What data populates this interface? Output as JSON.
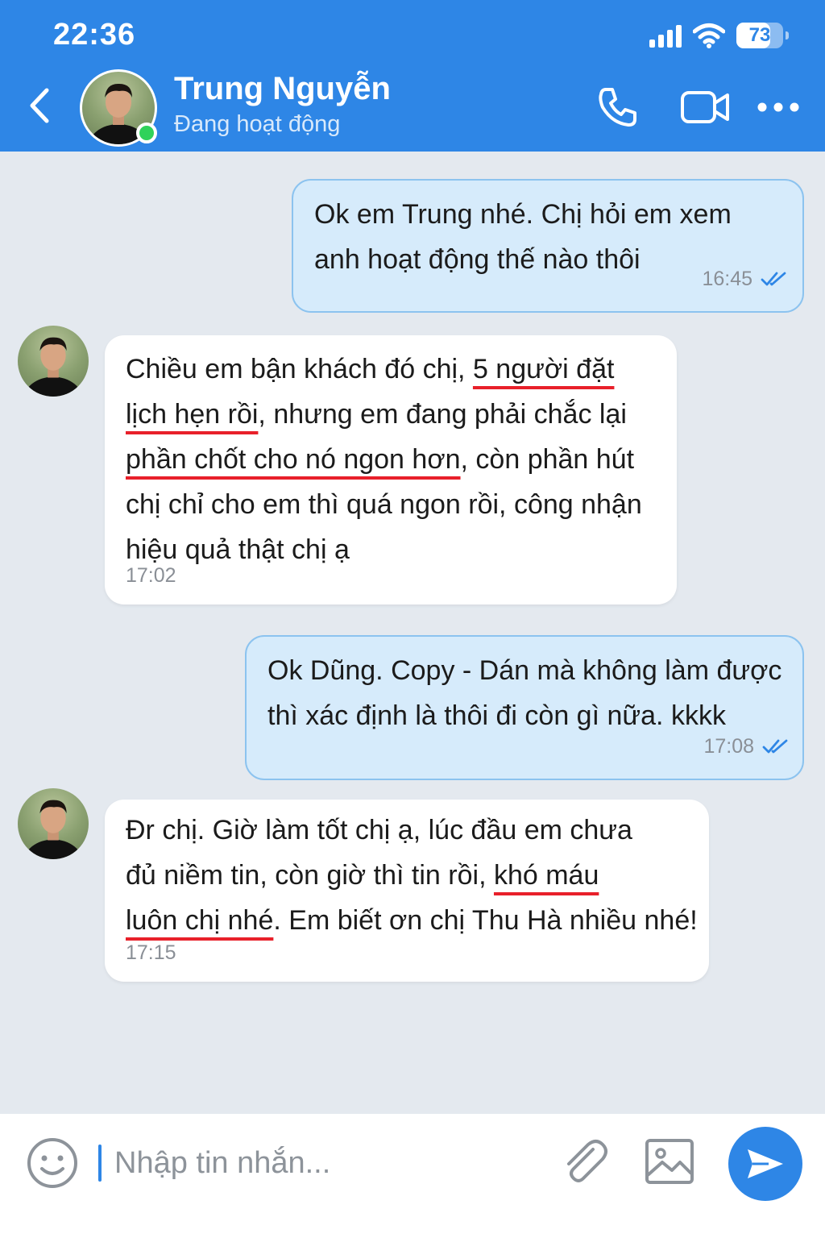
{
  "status_bar": {
    "time": "22:36",
    "battery": "73"
  },
  "header": {
    "contact_name": "Trung Nguyễn",
    "contact_status": "Đang hoạt động",
    "icons": [
      "back-icon",
      "phone-icon",
      "video-icon",
      "more-icon"
    ]
  },
  "messages": [
    {
      "direction": "outgoing",
      "lines": [
        "Ok em Trung nhé. Chị hỏi em xem",
        "anh hoạt động thế nào thôi"
      ],
      "time": "16:45",
      "status": "read"
    },
    {
      "direction": "incoming",
      "line1_pre": "Chiều em bận khách đó chị, ",
      "line1_u": "5 người đặt",
      "line2_u": "lịch hẹn rồi",
      "line2_post": ", nhưng em đang phải chắc lại",
      "line3_u": "phần chốt cho nó ngon hơn",
      "line3_post": ", còn phần hút",
      "line4": "chị chỉ cho em thì quá ngon rồi, công nhận",
      "line5": "hiệu quả thật chị ạ",
      "time": "17:02"
    },
    {
      "direction": "outgoing",
      "lines": [
        "Ok Dũng. Copy - Dán mà không làm được",
        "thì xác định là thôi đi còn gì nữa. kkkk"
      ],
      "time": "17:08",
      "status": "read"
    },
    {
      "direction": "incoming",
      "line1": "Đr chị. Giờ làm tốt chị ạ, lúc đầu em chưa",
      "line2_pre": "đủ niềm tin, còn giờ thì tin rồi, ",
      "line2_u": "khó máu ",
      "line3_u": "luôn chị nhé",
      "line3_post": ". Em biết ơn chị Thu Hà nhiều nhé!",
      "time": "17:15"
    }
  ],
  "composer": {
    "placeholder": "Nhập tin nhắn...",
    "icons": [
      "emoji-icon",
      "paperclip-icon",
      "image-icon",
      "send-icon"
    ]
  },
  "colors": {
    "brand": "#2e86e6",
    "outgoing_bubble": "#d6ebfb",
    "incoming_bubble": "#ffffff",
    "underline": "#e8202a",
    "online": "#2fd25a",
    "chat_bg": "#e4e9ef"
  }
}
